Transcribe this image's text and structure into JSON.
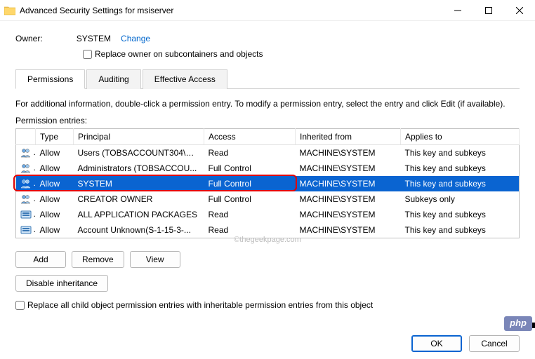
{
  "titlebar": {
    "title": "Advanced Security Settings for msiserver"
  },
  "owner": {
    "label": "Owner:",
    "value": "SYSTEM",
    "change_link": "Change",
    "replace_checkbox": "Replace owner on subcontainers and objects"
  },
  "tabs": {
    "permissions": "Permissions",
    "auditing": "Auditing",
    "effective": "Effective Access"
  },
  "info_text": "For additional information, double-click a permission entry. To modify a permission entry, select the entry and click Edit (if available).",
  "entries_label": "Permission entries:",
  "columns": {
    "type": "Type",
    "principal": "Principal",
    "access": "Access",
    "inherited": "Inherited from",
    "applies": "Applies to"
  },
  "rows": [
    {
      "icon": "users",
      "type": "Allow",
      "principal": "Users (TOBSACCOUNT304\\Us...",
      "access": "Read",
      "inherited": "MACHINE\\SYSTEM",
      "applies": "This key and subkeys",
      "selected": false
    },
    {
      "icon": "users",
      "type": "Allow",
      "principal": "Administrators (TOBSACCOU...",
      "access": "Full Control",
      "inherited": "MACHINE\\SYSTEM",
      "applies": "This key and subkeys",
      "selected": false
    },
    {
      "icon": "users",
      "type": "Allow",
      "principal": "SYSTEM",
      "access": "Full Control",
      "inherited": "MACHINE\\SYSTEM",
      "applies": "This key and subkeys",
      "selected": true
    },
    {
      "icon": "user",
      "type": "Allow",
      "principal": "CREATOR OWNER",
      "access": "Full Control",
      "inherited": "MACHINE\\SYSTEM",
      "applies": "Subkeys only",
      "selected": false
    },
    {
      "icon": "pkg",
      "type": "Allow",
      "principal": "ALL APPLICATION PACKAGES",
      "access": "Read",
      "inherited": "MACHINE\\SYSTEM",
      "applies": "This key and subkeys",
      "selected": false
    },
    {
      "icon": "pkg",
      "type": "Allow",
      "principal": "Account Unknown(S-1-15-3-...",
      "access": "Read",
      "inherited": "MACHINE\\SYSTEM",
      "applies": "This key and subkeys",
      "selected": false
    }
  ],
  "buttons": {
    "add": "Add",
    "remove": "Remove",
    "view": "View",
    "disable_inheritance": "Disable inheritance",
    "ok": "OK",
    "cancel": "Cancel"
  },
  "replace_all": "Replace all child object permission entries with inheritable permission entries from this object",
  "watermark": "©thegeekpage.com",
  "php_badge": "php"
}
